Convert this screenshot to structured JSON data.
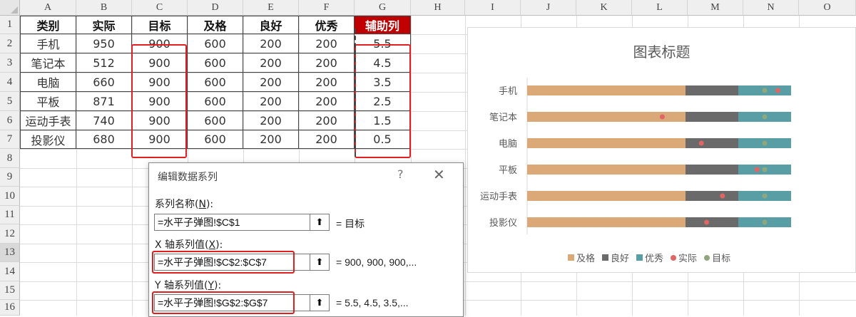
{
  "columns": [
    "A",
    "B",
    "C",
    "D",
    "E",
    "F",
    "G",
    "H",
    "I",
    "J",
    "K",
    "L",
    "M",
    "N",
    "O"
  ],
  "rows": [
    "1",
    "2",
    "3",
    "4",
    "5",
    "6",
    "7",
    "8",
    "9",
    "10",
    "11",
    "12",
    "13",
    "14",
    "15",
    "16"
  ],
  "table": {
    "headers": [
      "类别",
      "实际",
      "目标",
      "及格",
      "良好",
      "优秀",
      "辅助列"
    ],
    "rows": [
      [
        "手机",
        "950",
        "900",
        "600",
        "200",
        "200",
        "5.5"
      ],
      [
        "笔记本",
        "512",
        "900",
        "600",
        "200",
        "200",
        "4.5"
      ],
      [
        "电脑",
        "660",
        "900",
        "600",
        "200",
        "200",
        "3.5"
      ],
      [
        "平板",
        "871",
        "900",
        "600",
        "200",
        "200",
        "2.5"
      ],
      [
        "运动手表",
        "740",
        "900",
        "600",
        "200",
        "200",
        "1.5"
      ],
      [
        "投影仪",
        "680",
        "900",
        "600",
        "200",
        "200",
        "0.5"
      ]
    ]
  },
  "chart_data": {
    "type": "bar",
    "title": "图表标题",
    "categories": [
      "手机",
      "笔记本",
      "电脑",
      "平板",
      "运动手表",
      "投影仪"
    ],
    "series": [
      {
        "name": "及格",
        "values": [
          600,
          600,
          600,
          600,
          600,
          600
        ],
        "color": "#dba878"
      },
      {
        "name": "良好",
        "values": [
          200,
          200,
          200,
          200,
          200,
          200
        ],
        "color": "#6a6a6a"
      },
      {
        "name": "优秀",
        "values": [
          200,
          200,
          200,
          200,
          200,
          200
        ],
        "color": "#5a9ea5"
      }
    ],
    "points": [
      {
        "name": "实际",
        "values": [
          950,
          512,
          660,
          871,
          740,
          680
        ],
        "color": "#e06666"
      },
      {
        "name": "目标",
        "values": [
          900,
          900,
          900,
          900,
          900,
          900
        ],
        "color": "#8fa67f"
      }
    ],
    "xlim": [
      0,
      1000
    ],
    "legend": "bottom",
    "grid": false
  },
  "dialog": {
    "title": "编辑数据系列",
    "help": "?",
    "close": "✕",
    "series_name_label": "系列名称(",
    "series_name_key": "N",
    "series_name_end": "):",
    "series_name_value": "=水平子弹图!$C$1",
    "series_name_eq": "= 目标",
    "x_label": "X 轴系列值(",
    "x_key": "X",
    "x_end": "):",
    "x_value": "=水平子弹图!$C$2:$C$7",
    "x_eq": "= 900, 900, 900,...",
    "y_label": "Y 轴系列值(",
    "y_key": "Y",
    "y_end": "):",
    "y_value": "=水平子弹图!$G$2:$G$7",
    "y_eq": "= 5.5, 4.5, 3.5,...",
    "collapse_icon": "upload-arrow-icon"
  }
}
